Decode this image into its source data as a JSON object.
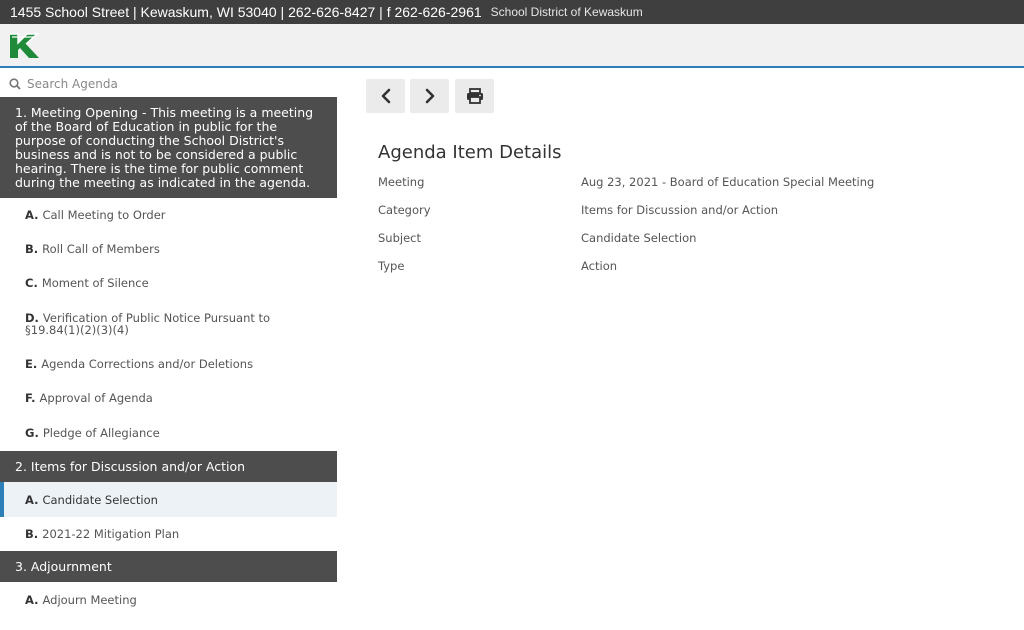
{
  "topbar": {
    "address": "1455 School Street | Kewaskum, WI 53040 | 262-626-8427 | f 262-626-2961",
    "district": "School District of Kewaskum"
  },
  "brand": {
    "accent": "#2d7fb8",
    "logo_green": "#1f8a3a"
  },
  "sidebar": {
    "search_placeholder": "Search Agenda",
    "sections": [
      {
        "title": "1. Meeting Opening - This meeting is a meeting of the Board of Education in public for the purpose of conducting the School District's business and is not to be considered a public hearing. There is the time for public comment during the meeting as indicated in the agenda.",
        "items": [
          {
            "letter": "A.",
            "label": "Call Meeting to Order"
          },
          {
            "letter": "B.",
            "label": "Roll Call of Members"
          },
          {
            "letter": "C.",
            "label": "Moment of Silence"
          },
          {
            "letter": "D.",
            "label": "Verification of Public Notice Pursuant to §19.84(1)(2)(3)(4)"
          },
          {
            "letter": "E.",
            "label": "Agenda Corrections and/or Deletions"
          },
          {
            "letter": "F.",
            "label": "Approval of Agenda"
          },
          {
            "letter": "G.",
            "label": "Pledge of Allegiance"
          }
        ]
      },
      {
        "title": "2. Items for Discussion and/or Action",
        "items": [
          {
            "letter": "A.",
            "label": "Candidate Selection",
            "selected": true
          },
          {
            "letter": "B.",
            "label": "2021-22 Mitigation Plan"
          }
        ]
      },
      {
        "title": "3. Adjournment",
        "items": [
          {
            "letter": "A.",
            "label": "Adjourn Meeting"
          }
        ]
      }
    ]
  },
  "toolbar": {
    "prev_icon": "chevron-left-icon",
    "next_icon": "chevron-right-icon",
    "print_icon": "printer-icon"
  },
  "details": {
    "title": "Agenda Item Details",
    "rows": [
      {
        "label": "Meeting",
        "value": "Aug 23, 2021 - Board of Education Special Meeting"
      },
      {
        "label": "Category",
        "value": "Items for Discussion and/or Action"
      },
      {
        "label": "Subject",
        "value": "Candidate Selection"
      },
      {
        "label": "Type",
        "value": "Action"
      }
    ]
  }
}
